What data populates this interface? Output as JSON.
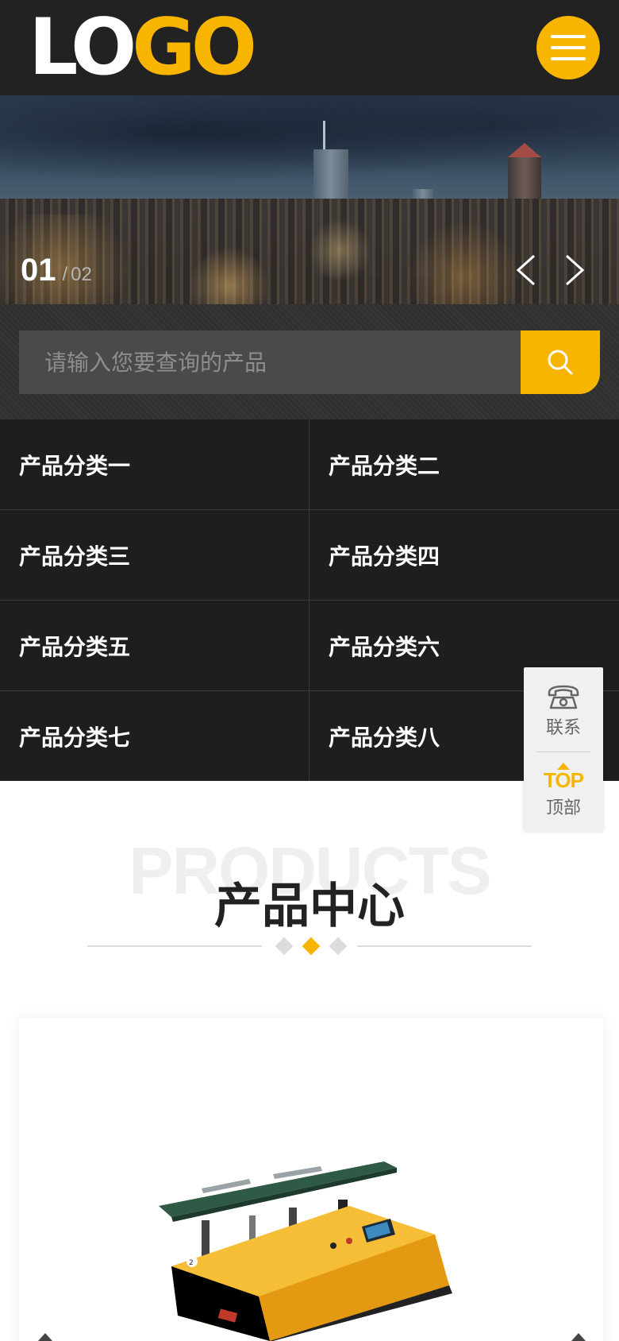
{
  "header": {
    "logo_part1": "LO",
    "logo_part2": "GO",
    "menu_icon": "hamburger-menu-icon"
  },
  "colors": {
    "accent": "#f7b500",
    "header_bg": "#222222",
    "category_bg": "#1e1e1e"
  },
  "banner": {
    "current_slide": "01",
    "separator": "/",
    "total_slides": "02",
    "prev_icon": "chevron-left-icon",
    "next_icon": "chevron-right-icon"
  },
  "search": {
    "placeholder": "请输入您要查询的产品",
    "icon": "search-icon"
  },
  "categories": [
    {
      "label": "产品分类一"
    },
    {
      "label": "产品分类二"
    },
    {
      "label": "产品分类三"
    },
    {
      "label": "产品分类四"
    },
    {
      "label": "产品分类五"
    },
    {
      "label": "产品分类六"
    },
    {
      "label": "产品分类七"
    },
    {
      "label": "产品分类八"
    }
  ],
  "side_widget": {
    "contact_label": "联系",
    "contact_icon": "telephone-icon",
    "top_text": "TOP",
    "top_label": "顶部"
  },
  "products": {
    "bg_word": "PRODUCTS",
    "title": "产品中心"
  }
}
